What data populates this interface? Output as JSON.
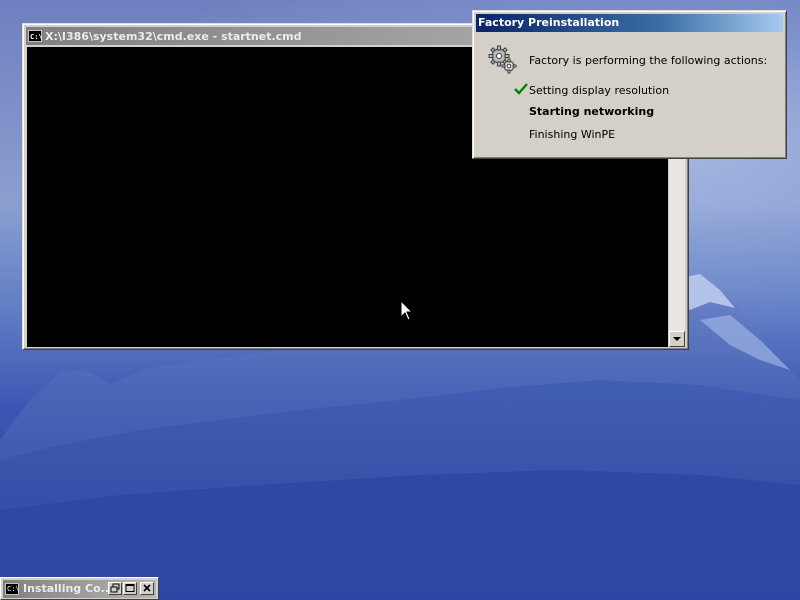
{
  "cmd_window": {
    "title": "X:\\I386\\system32\\cmd.exe - startnet.cmd",
    "icon_label": "C:\\"
  },
  "factory_dialog": {
    "title": "Factory Preinstallation",
    "heading": "Factory is performing the following actions:",
    "steps": [
      {
        "label": "Setting display resolution",
        "status": "completed"
      },
      {
        "label": "Starting networking",
        "status": "in-progress"
      },
      {
        "label": "Finishing WinPE",
        "status": "pending"
      }
    ]
  },
  "minimized_window": {
    "title": "Installing Co...",
    "icon_label": "C:\\"
  },
  "colors": {
    "active_title_start": "#0a246a",
    "active_title_end": "#a6caf0",
    "inactive_title": "#808080",
    "window_face": "#d4d0c8",
    "check_green": "#008000"
  }
}
